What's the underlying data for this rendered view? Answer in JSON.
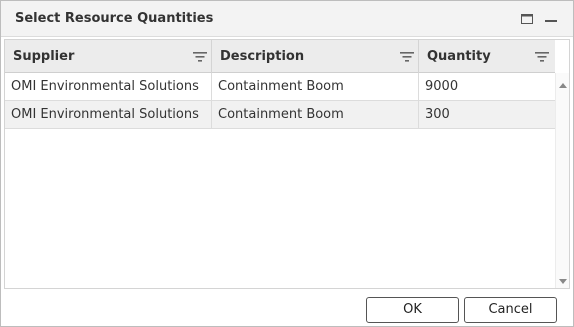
{
  "dialog": {
    "title": "Select Resource Quantities",
    "maximize_icon": "window-maximize-icon",
    "minimize_icon": "window-minimize-icon"
  },
  "grid": {
    "columns": [
      {
        "label": "Supplier",
        "icon": "filter-icon"
      },
      {
        "label": "Description",
        "icon": "filter-icon"
      },
      {
        "label": "Quantity",
        "icon": "filter-icon"
      }
    ],
    "rows": [
      {
        "supplier": "OMI Environmental Solutions",
        "description": "Containment Boom",
        "quantity": "9000"
      },
      {
        "supplier": "OMI Environmental Solutions",
        "description": "Containment Boom",
        "quantity": "300"
      }
    ]
  },
  "buttons": {
    "ok": "OK",
    "cancel": "Cancel"
  },
  "colors": {
    "titlebar": "#f3f3f3",
    "header": "#ececec",
    "alt_row": "#f1f1f1",
    "border": "#d4d4d4"
  }
}
